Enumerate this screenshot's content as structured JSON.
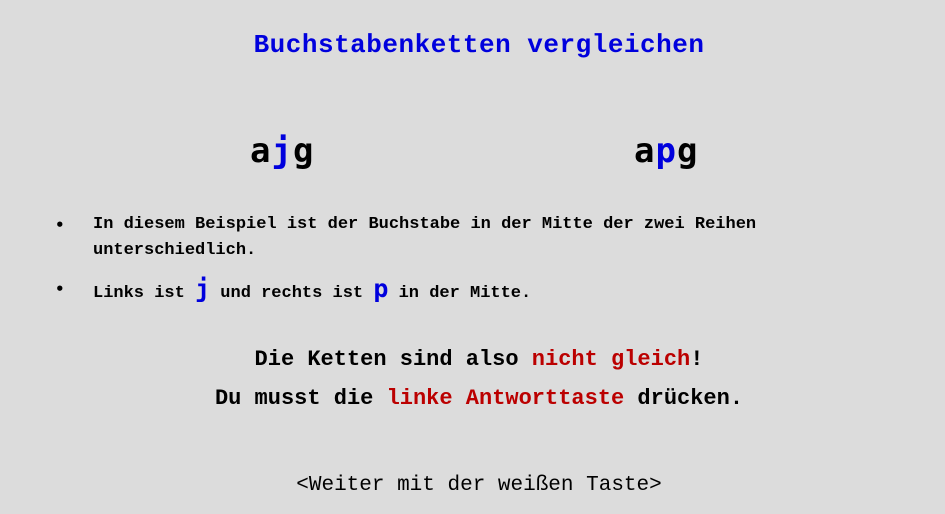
{
  "title": "Buchstabenketten vergleichen",
  "left_string": {
    "first": "a",
    "middle": "j",
    "last": "g"
  },
  "right_string": {
    "first": "a",
    "middle": "p",
    "last": "g"
  },
  "bullets": [
    {
      "text": "In diesem Beispiel ist der Buchstabe in der Mitte der zwei Reihen unterschiedlich."
    },
    {
      "part1": "Links ist",
      "letter1": "j",
      "part2": "und rechts ist",
      "letter2": "p",
      "part3": "in der Mitte."
    }
  ],
  "conclusion": {
    "line1_prefix": "Die Ketten sind also",
    "line1_highlight": "nicht gleich",
    "line1_suffix": "!",
    "line2_prefix": "Du musst die",
    "line2_highlight": "linke Antworttaste",
    "line2_suffix": "drücken."
  },
  "footer": "<Weiter mit der weißen Taste>",
  "colors": {
    "background": "#dcdcdc",
    "blue": "#0000dd",
    "red": "#bb0000",
    "text": "#000000"
  }
}
